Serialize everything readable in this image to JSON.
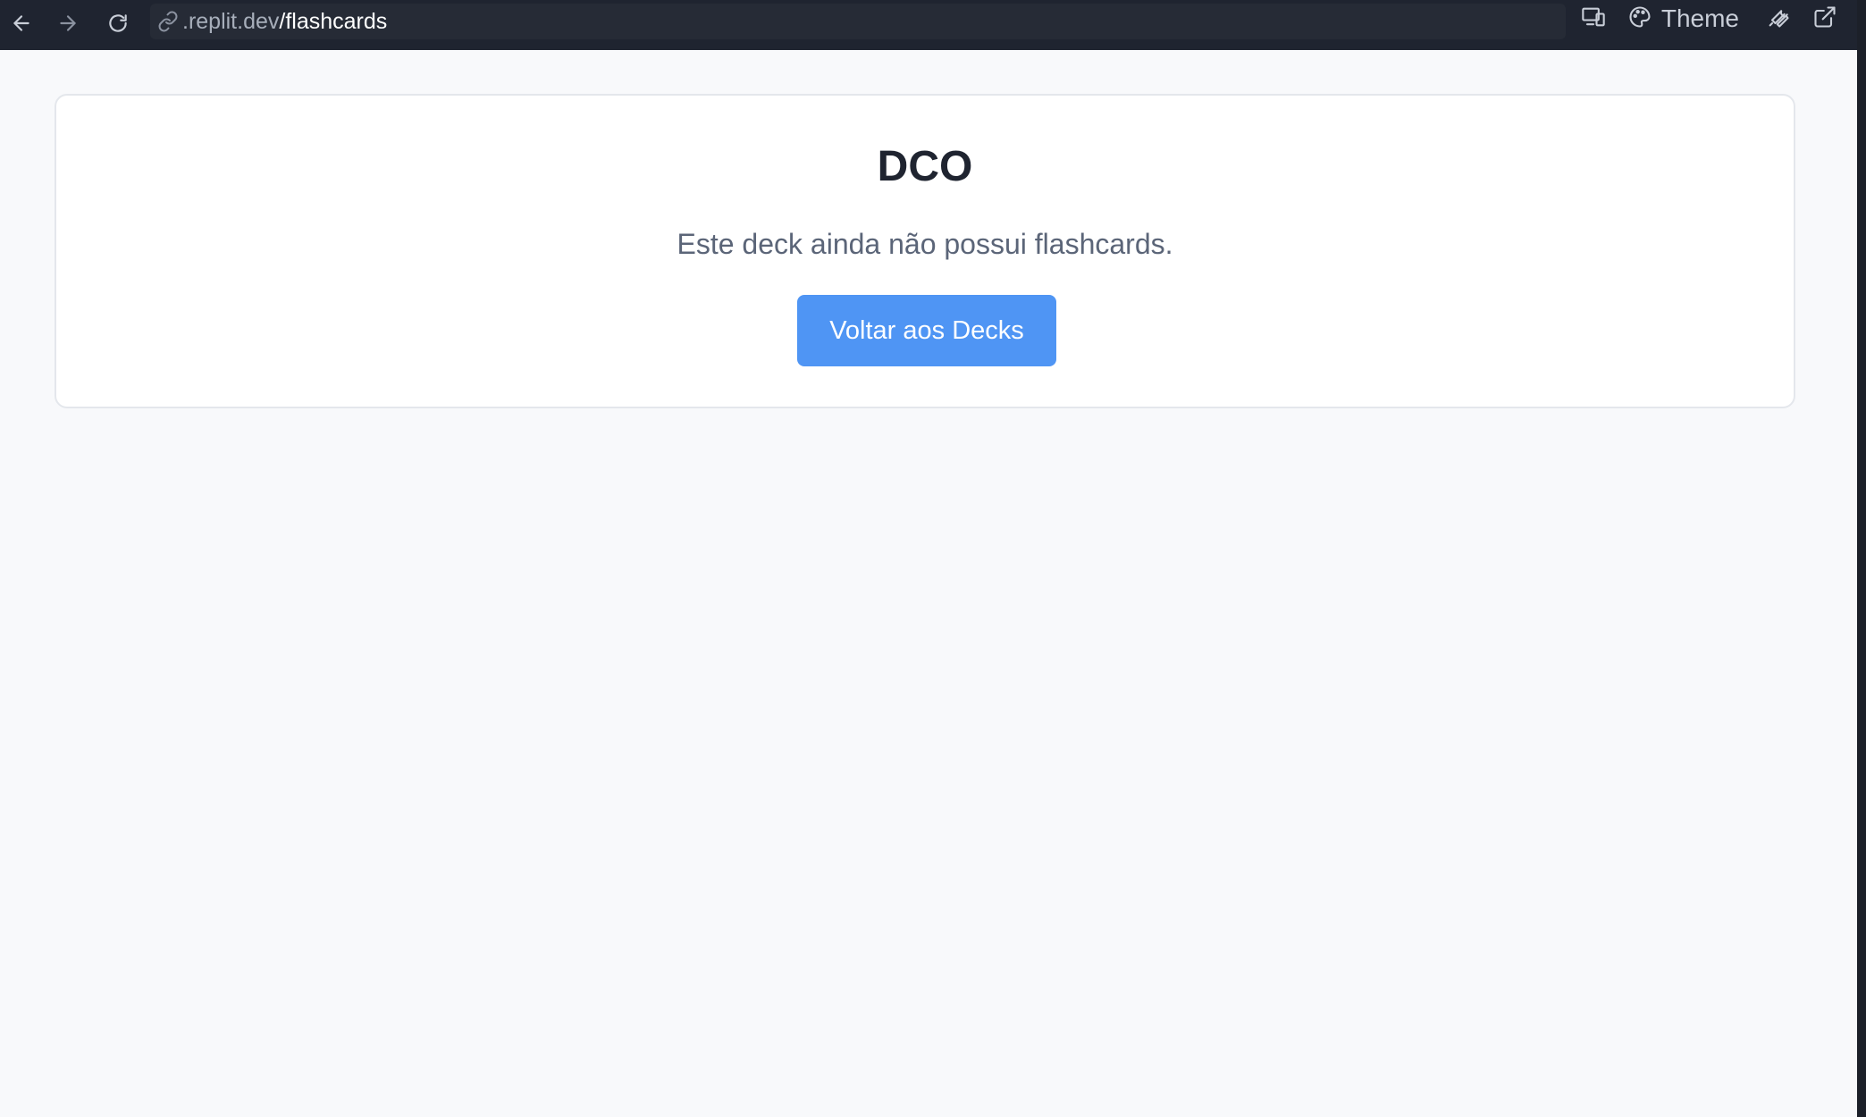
{
  "browser": {
    "url_host": ".replit.dev",
    "url_path": "/flashcards",
    "theme_label": "Theme",
    "icons": [
      "back-arrow-icon",
      "forward-arrow-icon",
      "reload-icon",
      "link-icon",
      "devices-icon",
      "palette-icon",
      "wrench-icon",
      "external-link-icon"
    ]
  },
  "deck": {
    "title": "DCO",
    "empty_message": "Este deck ainda não possui flashcards.",
    "back_button_label": "Voltar aos Decks"
  },
  "colors": {
    "topbar": "#1f2430",
    "page_background": "#f8f9fb",
    "button_primary": "#4f95f4"
  }
}
